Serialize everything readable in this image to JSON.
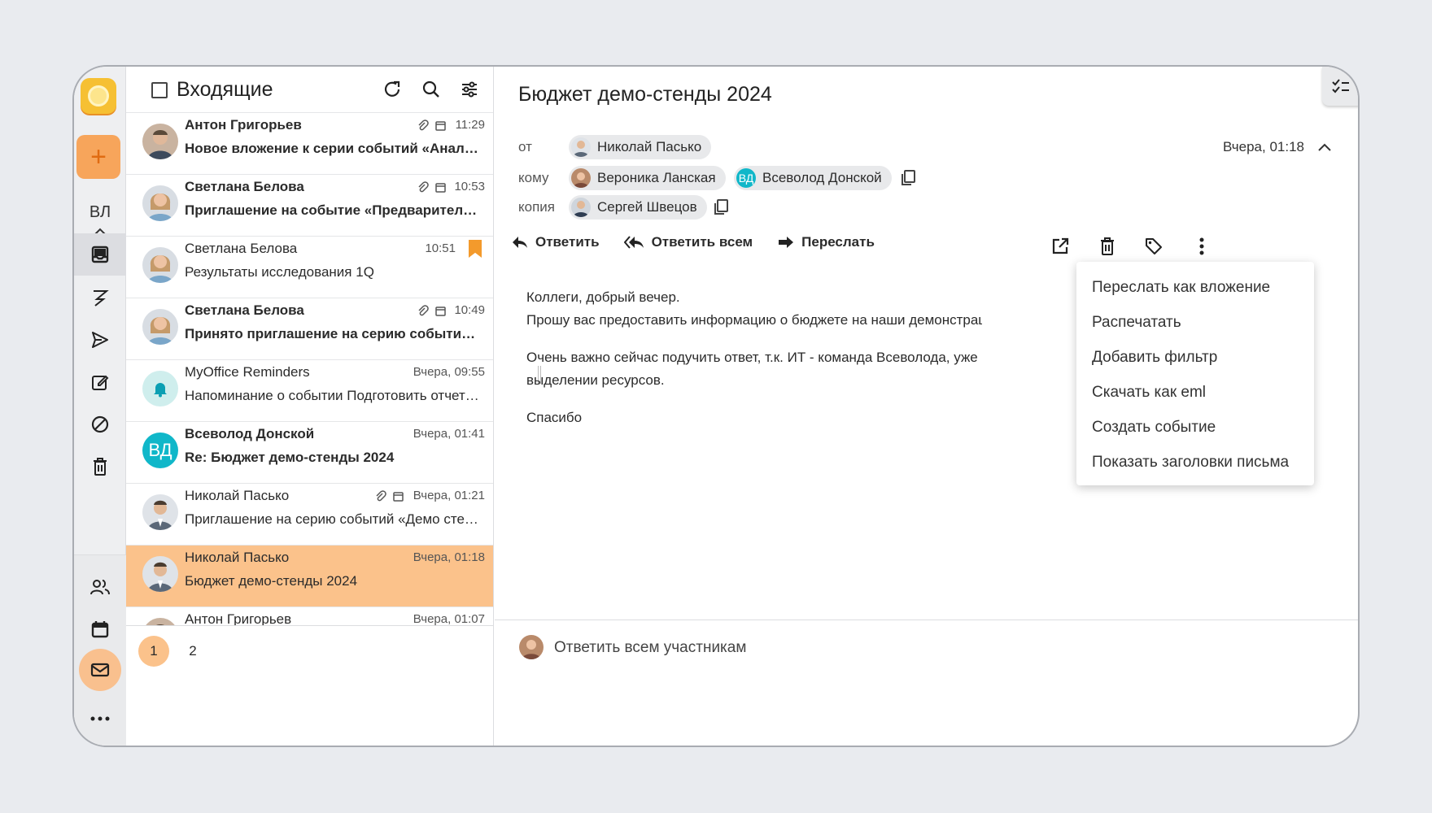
{
  "rail": {
    "user_initials": "ВЛ"
  },
  "list": {
    "title": "Входящие",
    "rows": [
      {
        "sender": "Антон Григорьев",
        "subject": "Новое вложение к серии событий «Аналити…",
        "time": "11:29",
        "unread": true,
        "attachment": true,
        "calendar": true,
        "bookmark": false
      },
      {
        "sender": "Светлана Белова",
        "subject": "Приглашение на событие «Предварительно…",
        "time": "10:53",
        "unread": true,
        "attachment": true,
        "calendar": true,
        "bookmark": false
      },
      {
        "sender": "Светлана Белова",
        "subject": "Результаты исследования 1Q",
        "time": "10:51",
        "unread": false,
        "attachment": false,
        "calendar": false,
        "bookmark": true
      },
      {
        "sender": "Светлана Белова",
        "subject": "Принято приглашение на серию событий «…",
        "time": "10:49",
        "unread": true,
        "attachment": true,
        "calendar": true,
        "bookmark": false
      },
      {
        "sender": "MyOffice Reminders",
        "subject": "Напоминание о событии Подготовить отчет…",
        "time": "Вчера, 09:55",
        "unread": false,
        "attachment": false,
        "calendar": false,
        "bookmark": false
      },
      {
        "sender": "Всеволод Донской",
        "subject": "Re: Бюджет демо-стенды 2024",
        "time": "Вчера, 01:41",
        "unread": true,
        "attachment": false,
        "calendar": false,
        "bookmark": false,
        "initials": "ВД"
      },
      {
        "sender": "Николай Пасько",
        "subject": "Приглашение на серию событий «Демо стен…",
        "time": "Вчера, 01:21",
        "unread": false,
        "attachment": true,
        "calendar": true,
        "bookmark": false
      },
      {
        "sender": "Николай Пасько",
        "subject": "Бюджет демо-стенды 2024",
        "time": "Вчера, 01:18",
        "unread": false,
        "attachment": false,
        "calendar": false,
        "bookmark": false,
        "selected": true
      },
      {
        "sender": "Антон Григорьев",
        "subject": "",
        "time": "Вчера, 01:07",
        "unread": false,
        "attachment": false,
        "calendar": false,
        "bookmark": false
      }
    ],
    "pages": [
      "1",
      "2"
    ]
  },
  "message": {
    "subject": "Бюджет демо-стенды 2024",
    "from_label": "от",
    "to_label": "кому",
    "cc_label": "копия",
    "from": "Николай Пасько",
    "to": [
      "Вероника Ланская",
      "Всеволод Донской"
    ],
    "to_initials": "ВД",
    "cc": "Сергей Швецов",
    "date": "Вчера, 01:18",
    "actions": {
      "reply": "Ответить",
      "reply_all": "Ответить всем",
      "forward": "Переслать"
    },
    "body": [
      "Коллеги, добрый вечер.",
      "Прошу вас предоставить информацию о бюджете на наши демонстраци",
      "Очень важно сейчас подучить ответ, т.к. ИТ - команда Всеволода, уже",
      "выделении ресурсов.",
      "Спасибо"
    ],
    "reply_placeholder": "Ответить всем участникам"
  },
  "menu": {
    "items": [
      "Переслать как вложение",
      "Распечатать",
      "Добавить фильтр",
      "Скачать как eml",
      "Создать событие",
      "Показать заголовки письма"
    ]
  },
  "colors": {
    "accent": "#fbc28b",
    "compose": "#f7a55b",
    "bookmark": "#f39a2c",
    "initials_avatar": "#10b7c9"
  }
}
